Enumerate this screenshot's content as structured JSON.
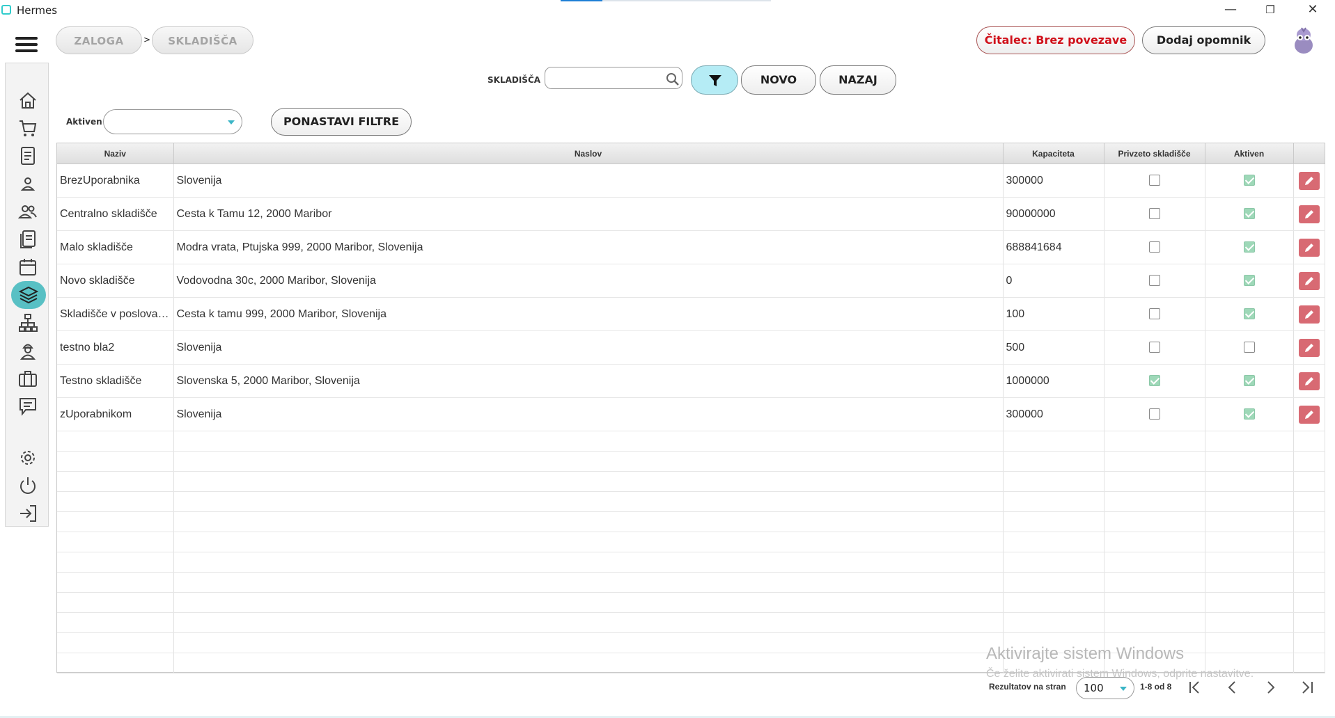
{
  "window": {
    "title": "Hermes",
    "min_icon": "—",
    "max_icon": "❐",
    "close_icon": "✕"
  },
  "breadcrumb": {
    "items": [
      "ZALOGA",
      "SKLADIŠČA"
    ],
    "separator": ">"
  },
  "header": {
    "reader_status": "Čitalec: Brez povezave",
    "add_reminder": "Dodaj opomnik",
    "reader_color": "#d0101a"
  },
  "search": {
    "label": "SKLADIŠČA",
    "value": "",
    "placeholder": ""
  },
  "toolbar": {
    "new_label": "NOVO",
    "back_label": "NAZAJ",
    "filter_color": "#b5ecf5"
  },
  "filters": {
    "aktiven_label": "Aktiven",
    "aktiven_value": "",
    "reset_label": "PONASTAVI FILTRE"
  },
  "sidebar": {
    "items": [
      "home-icon",
      "cart-icon",
      "document-icon",
      "user-icon",
      "users-icon",
      "list-icon",
      "calendar-icon",
      "layers-icon",
      "network-icon",
      "worker-icon",
      "briefcase-icon",
      "chat-icon",
      "gear-icon",
      "power-icon",
      "logout-icon"
    ],
    "active": "layers-icon",
    "accent": "#58c0c4"
  },
  "table": {
    "columns": [
      "Naziv",
      "Naslov",
      "Kapaciteta",
      "Privzeto skladišče",
      "Aktiven"
    ],
    "rows": [
      {
        "naziv": "BrezUporabnika",
        "naslov": "Slovenija",
        "kapaciteta": "300000",
        "privzeto": false,
        "aktiven": true
      },
      {
        "naziv": "Centralno skladišče",
        "naslov": "Cesta k Tamu 12, 2000 Maribor",
        "kapaciteta": "90000000",
        "privzeto": false,
        "aktiven": true
      },
      {
        "naziv": "Malo skladišče",
        "naslov": "Modra vrata, Ptujska 999, 2000 Maribor, Slovenija",
        "kapaciteta": "688841684",
        "privzeto": false,
        "aktiven": true
      },
      {
        "naziv": "Novo skladišče",
        "naslov": "Vodovodna 30c, 2000 Maribor, Slovenija",
        "kapaciteta": "0",
        "privzeto": false,
        "aktiven": true
      },
      {
        "naziv": "Skladišče v poslovalnici",
        "naslov": "Cesta k tamu 999, 2000 Maribor, Slovenija",
        "kapaciteta": "100",
        "privzeto": false,
        "aktiven": true
      },
      {
        "naziv": "testno bla2",
        "naslov": "Slovenija",
        "kapaciteta": "500",
        "privzeto": false,
        "aktiven": false
      },
      {
        "naziv": "Testno skladišče",
        "naslov": "Slovenska 5, 2000 Maribor, Slovenija",
        "kapaciteta": "1000000",
        "privzeto": true,
        "aktiven": true
      },
      {
        "naziv": "zUporabnikom",
        "naslov": "Slovenija",
        "kapaciteta": "300000",
        "privzeto": false,
        "aktiven": true
      }
    ],
    "check_color": "#9ed8b8",
    "edit_color": "#d86a73"
  },
  "watermark": {
    "title": "Aktivirajte sistem Windows",
    "subtitle": "Če želite aktivirati sistem Windows, odprite nastavitve."
  },
  "pagination": {
    "label": "Rezultatov na stran",
    "page_size": "100",
    "range": "1-8 od 8"
  }
}
